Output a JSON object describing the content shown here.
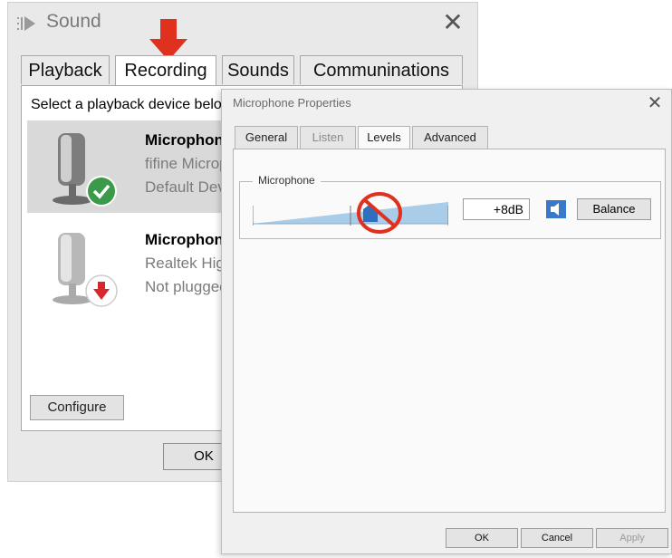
{
  "sound_window": {
    "title": "Sound",
    "close_glyph": "✕",
    "tabs": [
      {
        "label": "Playback"
      },
      {
        "label": "Recording",
        "active": true
      },
      {
        "label": "Sounds"
      },
      {
        "label": "Communinations"
      }
    ],
    "instructions": "Select a playback device below to modify its settings:",
    "devices": [
      {
        "name": "Microphone",
        "sub": "fifine Microphone",
        "status": "Default Device",
        "selected": true,
        "status_icon": "green-check-icon"
      },
      {
        "name": "Microphone",
        "sub": "Realtek High Definition Audio",
        "status": "Not plugged in",
        "selected": false,
        "status_icon": "red-down-arrow-icon"
      }
    ],
    "configure_label": "Configure",
    "ok_label": "OK"
  },
  "mic_window": {
    "title": "Microphone Properties",
    "close_glyph": "✕",
    "tabs": [
      {
        "label": "General"
      },
      {
        "label": "Listen"
      },
      {
        "label": "Levels",
        "active": true
      },
      {
        "label": "Advanced"
      }
    ],
    "group_label": "Microphone",
    "level_value": "+8dB",
    "balance_label": "Balance",
    "ok_label": "OK",
    "cancel_label": "Cancel",
    "apply_label": "Apply"
  },
  "colors": {
    "annotation_red": "#e0301e",
    "slider_blue": "#2f6fc0",
    "check_green": "#3a9a49",
    "disconnect_red": "#d8262e"
  }
}
